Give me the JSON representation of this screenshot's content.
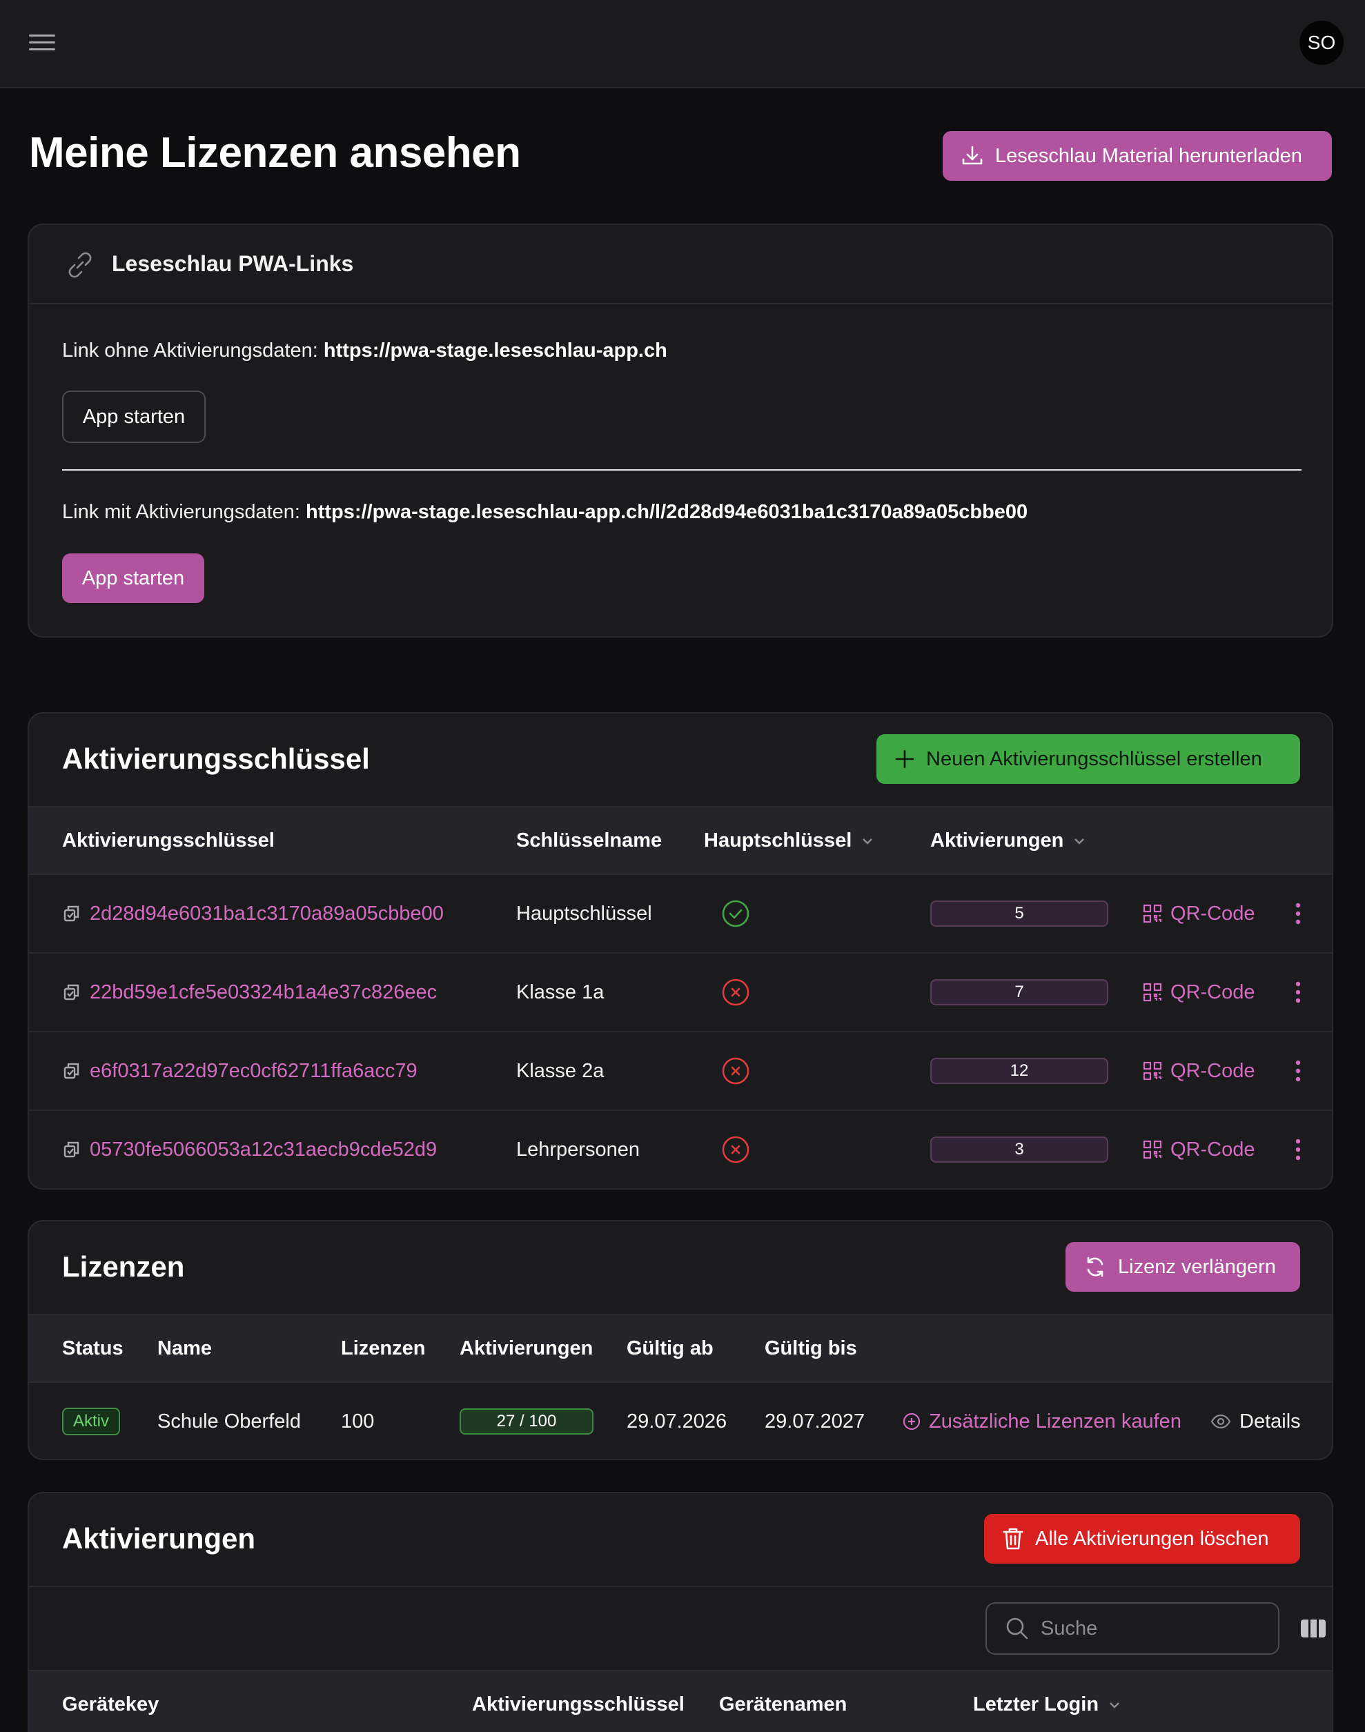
{
  "header": {
    "avatar_initials": "SO"
  },
  "page": {
    "title": "Meine Lizenzen ansehen",
    "download_button": "Leseschlau Material herunterladen"
  },
  "pwa": {
    "title": "Leseschlau PWA-Links",
    "link_without_label": "Link ohne Aktivierungsdaten:",
    "link_without_url": "https://pwa-stage.leseschlau-app.ch",
    "start_button_1": "App starten",
    "link_with_label": "Link mit Aktivierungsdaten:",
    "link_with_url": "https://pwa-stage.leseschlau-app.ch/l/2d28d94e6031ba1c3170a89a05cbbe00",
    "start_button_2": "App starten"
  },
  "keys": {
    "title": "Aktivierungsschlüssel",
    "create_button": "Neuen Aktivierungsschlüssel erstellen",
    "columns": {
      "key": "Aktivierungsschlüssel",
      "name": "Schlüsselname",
      "main": "Hauptschlüssel",
      "activations": "Aktivierungen"
    },
    "qr_label": "QR-Code",
    "rows": [
      {
        "key": "2d28d94e6031ba1c3170a89a05cbbe00",
        "name": "Hauptschlüssel",
        "main": true,
        "activations": "5"
      },
      {
        "key": "22bd59e1cfe5e03324b1a4e37c826eec",
        "name": "Klasse 1a",
        "main": false,
        "activations": "7"
      },
      {
        "key": "e6f0317a22d97ec0cf62711ffa6acc79",
        "name": "Klasse 2a",
        "main": false,
        "activations": "12"
      },
      {
        "key": "05730fe5066053a12c31aecb9cde52d9",
        "name": "Lehrpersonen",
        "main": false,
        "activations": "3"
      }
    ]
  },
  "licenses": {
    "title": "Lizenzen",
    "renew_button": "Lizenz verlängern",
    "columns": {
      "status": "Status",
      "name": "Name",
      "licenses": "Lizenzen",
      "activations": "Aktivierungen",
      "valid_from": "Gültig ab",
      "valid_to": "Gültig bis"
    },
    "rows": [
      {
        "status": "Aktiv",
        "name": "Schule Oberfeld",
        "licenses": "100",
        "activations": "27 / 100",
        "activations_fraction": 0.27,
        "valid_from": "29.07.2026",
        "valid_to": "29.07.2027",
        "buy_more": "Zusätzliche Lizenzen kaufen",
        "details": "Details"
      }
    ]
  },
  "activations": {
    "title": "Aktivierungen",
    "delete_all_button": "Alle Aktivierungen löschen",
    "search_placeholder": "Suche",
    "columns": {
      "device_key": "Gerätekey",
      "activation_key": "Aktivierungsschlüssel",
      "device_name": "Gerätenamen",
      "last_login": "Letzter Login"
    }
  },
  "colors": {
    "accent": "#b1539f",
    "success": "#3fa845",
    "danger": "#d92020",
    "background": "#0e0e10",
    "card": "#1b1b1e"
  }
}
